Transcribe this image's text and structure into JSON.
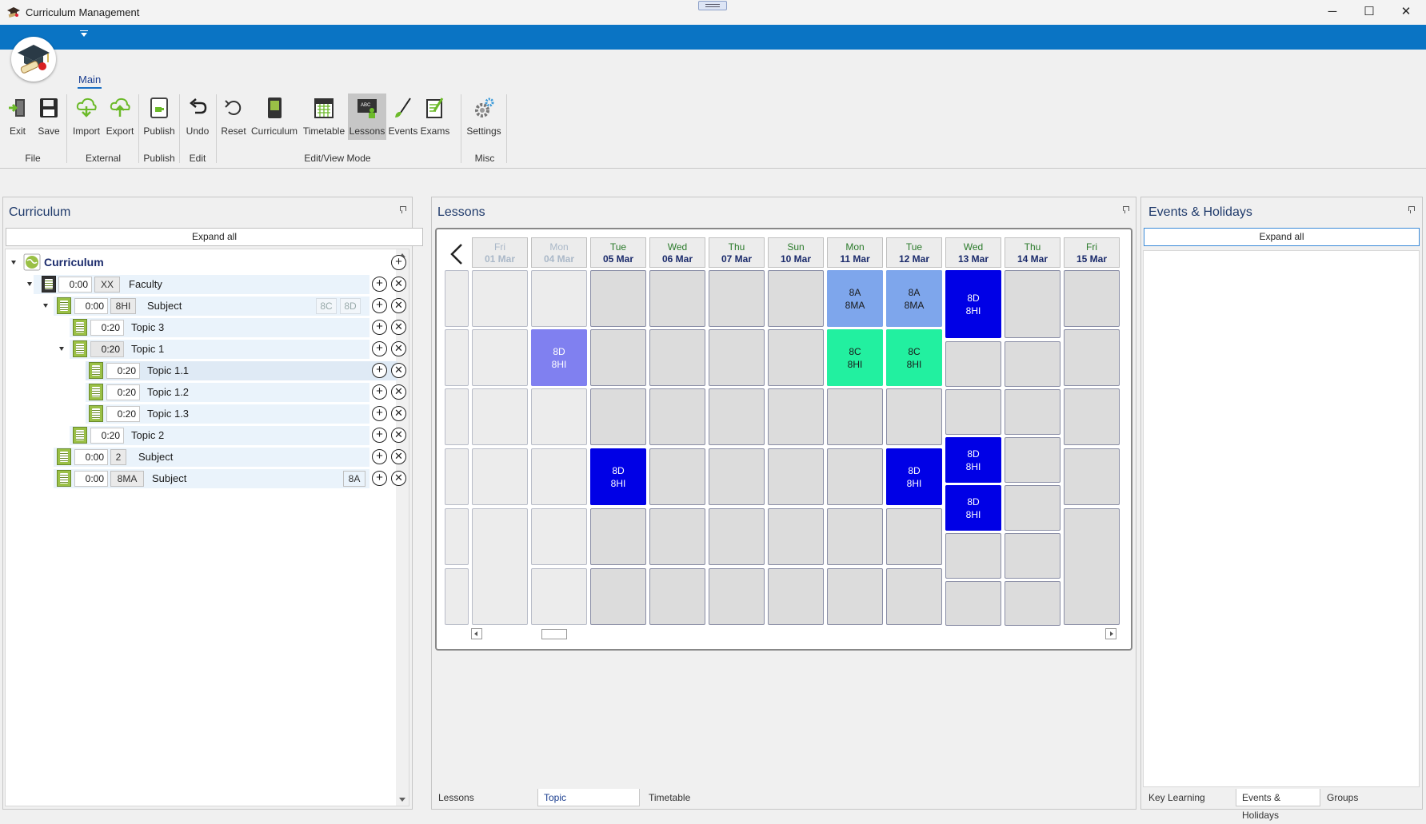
{
  "window": {
    "title": "Curriculum Management",
    "controls": {
      "minimize": "─",
      "maximize": "☐",
      "close": "✕"
    }
  },
  "ribbon": {
    "tab": "Main",
    "buttons": [
      {
        "label": "Exit",
        "icon": "exit-icon"
      },
      {
        "label": "Save",
        "icon": "save-icon"
      },
      {
        "label": "Import",
        "icon": "cloud-download-icon"
      },
      {
        "label": "Export",
        "icon": "cloud-upload-icon"
      },
      {
        "label": "Publish",
        "icon": "publish-icon"
      },
      {
        "label": "Undo",
        "icon": "undo-icon"
      },
      {
        "label": "Reset",
        "icon": "reset-icon"
      },
      {
        "label": "Curriculum",
        "icon": "book-icon"
      },
      {
        "label": "Timetable",
        "icon": "calendar-icon"
      },
      {
        "label": "Lessons",
        "icon": "whiteboard-icon",
        "active": true
      },
      {
        "label": "Events",
        "icon": "brush-icon"
      },
      {
        "label": "Exams",
        "icon": "exam-icon"
      },
      {
        "label": "Settings",
        "icon": "gears-icon"
      }
    ],
    "groups": [
      "File",
      "External",
      "Publish",
      "Edit",
      "Edit/View Mode",
      "Misc"
    ]
  },
  "curriculum_panel": {
    "title": "Curriculum",
    "expand_all": "Expand all",
    "root_label": "Curriculum",
    "nodes": [
      {
        "time": "0:00",
        "tag": "XX",
        "label": "Faculty"
      },
      {
        "time": "0:00",
        "tag": "8HI",
        "label": "Subject",
        "groups": [
          "8C",
          "8D"
        ]
      },
      {
        "time": "0:20",
        "label": "Topic 3"
      },
      {
        "time": "0:20",
        "label": "Topic 1"
      },
      {
        "time": "0:20",
        "label": "Topic 1.1"
      },
      {
        "time": "0:20",
        "label": "Topic 1.2"
      },
      {
        "time": "0:20",
        "label": "Topic 1.3"
      },
      {
        "time": "0:20",
        "label": "Topic 2"
      },
      {
        "time": "0:00",
        "tag": "2",
        "label": "Subject"
      },
      {
        "time": "0:00",
        "tag": "8MA",
        "label": "Subject",
        "groups": [
          "8A"
        ]
      }
    ],
    "add_symbol": "+",
    "remove_symbol": "✕"
  },
  "lessons_panel": {
    "title": "Lessons",
    "days": [
      {
        "name": "Fri",
        "date": "01 Mar",
        "in_range": false
      },
      {
        "name": "Mon",
        "date": "04 Mar",
        "in_range": false
      },
      {
        "name": "Tue",
        "date": "05 Mar",
        "in_range": true
      },
      {
        "name": "Wed",
        "date": "06 Mar",
        "in_range": true
      },
      {
        "name": "Thu",
        "date": "07 Mar",
        "in_range": true
      },
      {
        "name": "Sun",
        "date": "10 Mar",
        "in_range": true
      },
      {
        "name": "Mon",
        "date": "11 Mar",
        "in_range": true
      },
      {
        "name": "Tue",
        "date": "12 Mar",
        "in_range": true
      },
      {
        "name": "Wed",
        "date": "13 Mar",
        "in_range": true
      },
      {
        "name": "Thu",
        "date": "14 Mar",
        "in_range": true
      },
      {
        "name": "Fri",
        "date": "15 Mar",
        "in_range": true
      }
    ],
    "lessons": [
      {
        "group": "8A",
        "subject": "8MA",
        "color": "#7ea6ec",
        "text_color": "#1a1a1a"
      },
      {
        "group": "8A",
        "subject": "8MA",
        "color": "#7ea6ec",
        "text_color": "#1a1a1a"
      },
      {
        "group": "8D",
        "subject": "8HI",
        "color": "#0000e6",
        "text_color": "#ffffff"
      },
      {
        "group": "8D",
        "subject": "8HI",
        "color": "#8080f0",
        "text_color": "#ffffff"
      },
      {
        "group": "8C",
        "subject": "8HI",
        "color": "#22f0a0",
        "text_color": "#1a1a1a"
      },
      {
        "group": "8C",
        "subject": "8HI",
        "color": "#22f0a0",
        "text_color": "#1a1a1a"
      },
      {
        "group": "8D",
        "subject": "8HI",
        "color": "#0000e6",
        "text_color": "#ffffff"
      },
      {
        "group": "8D",
        "subject": "8HI",
        "color": "#0000e6",
        "text_color": "#ffffff"
      },
      {
        "group": "8D",
        "subject": "8HI",
        "color": "#0000e6",
        "text_color": "#ffffff"
      },
      {
        "group": "8D",
        "subject": "8HI",
        "color": "#0000e6",
        "text_color": "#ffffff"
      },
      {
        "group": "8D",
        "subject": "8HI",
        "color": "#0000e6",
        "text_color": "#ffffff"
      }
    ],
    "bottom_tabs": [
      "Lessons",
      "Topic",
      "Timetable"
    ]
  },
  "events_panel": {
    "title": "Events & Holidays",
    "expand_all": "Expand all",
    "bottom_tabs": [
      "Key Learning",
      "Events & Holidays",
      "Groups"
    ]
  }
}
